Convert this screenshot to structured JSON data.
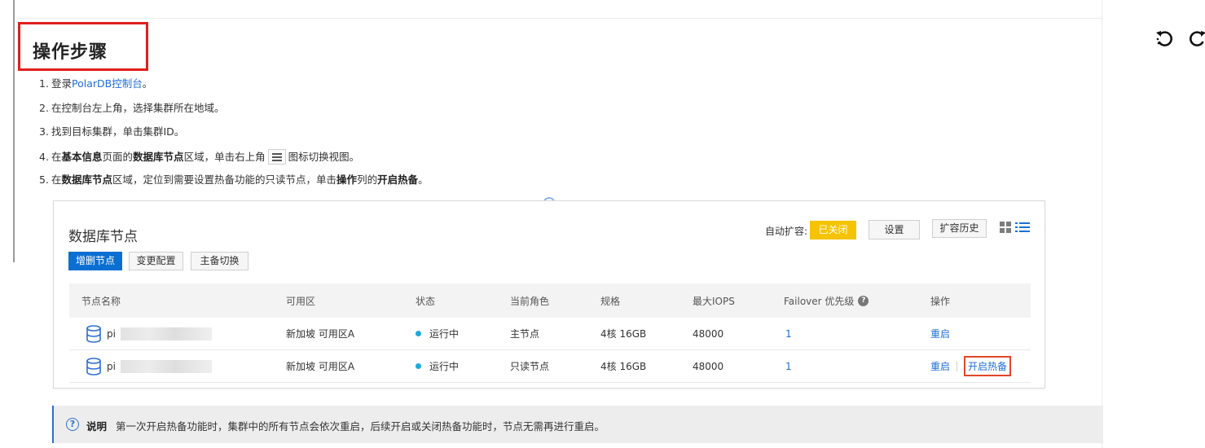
{
  "page": {
    "title": "操作步骤"
  },
  "steps": [
    {
      "num": "1.",
      "parts": [
        {
          "t": "登录",
          "style": "normal"
        },
        {
          "t": "PolarDB控制台",
          "style": "link"
        },
        {
          "t": "。",
          "style": "normal"
        }
      ]
    },
    {
      "num": "2.",
      "parts": [
        {
          "t": "在控制台左上角，选择集群所在地域。",
          "style": "normal"
        }
      ]
    },
    {
      "num": "3.",
      "parts": [
        {
          "t": "找到目标集群，单击集群ID。",
          "style": "normal"
        }
      ]
    },
    {
      "num": "4.",
      "parts": [
        {
          "t": "在",
          "style": "normal"
        },
        {
          "t": "基本信息",
          "style": "bold"
        },
        {
          "t": "页面的",
          "style": "normal"
        },
        {
          "t": "数据库节点",
          "style": "bold"
        },
        {
          "t": "区域，单击右上角",
          "style": "normal"
        },
        {
          "t": "list-icon",
          "style": "icon"
        },
        {
          "t": "图标切换视图。",
          "style": "normal"
        }
      ]
    },
    {
      "num": "5.",
      "parts": [
        {
          "t": "在",
          "style": "normal"
        },
        {
          "t": "数据库节点",
          "style": "bold"
        },
        {
          "t": "区域，定位到需要设置热备功能的只读节点，单击",
          "style": "normal"
        },
        {
          "t": "操作",
          "style": "bold"
        },
        {
          "t": "列的",
          "style": "normal"
        },
        {
          "t": "开启热备",
          "style": "bold"
        },
        {
          "t": "。",
          "style": "normal"
        }
      ]
    }
  ],
  "panel": {
    "title": "数据库节点",
    "buttons": {
      "add_remove": "增删节点",
      "change_config": "变更配置",
      "switch": "主备切换",
      "settings": "设置",
      "history": "扩容历史"
    },
    "auto_scale_label": "自动扩容:",
    "auto_scale_status": "已关闭",
    "columns": [
      "节点名称",
      "可用区",
      "状态",
      "当前角色",
      "规格",
      "最大IOPS",
      "Failover 优先级",
      "操作"
    ],
    "rows": [
      {
        "name": "pi",
        "zone": "新加坡 可用区A",
        "status": "运行中",
        "role": "主节点",
        "spec": "4核 16GB",
        "iops": "48000",
        "failover": "1",
        "actions": [
          "重启"
        ]
      },
      {
        "name": "pi",
        "zone": "新加坡 可用区A",
        "status": "运行中",
        "role": "只读节点",
        "spec": "4核 16GB",
        "iops": "48000",
        "failover": "1",
        "actions": [
          "重启",
          "开启热备"
        ]
      }
    ]
  },
  "note": {
    "title": "说明",
    "text": "第一次开启热备功能时，集群中的所有节点会依次重启，后续开启或关闭热备功能时，节点无需再进行重启。"
  },
  "toolbar_icons": [
    "rotate-left-icon",
    "rotate-right-icon"
  ],
  "colors": {
    "accent": "#0b6fd2",
    "link": "#1f6fd6",
    "highlight": "#e0201b",
    "status_dot": "#1fa8d8",
    "badge_off": "#f5c300"
  }
}
